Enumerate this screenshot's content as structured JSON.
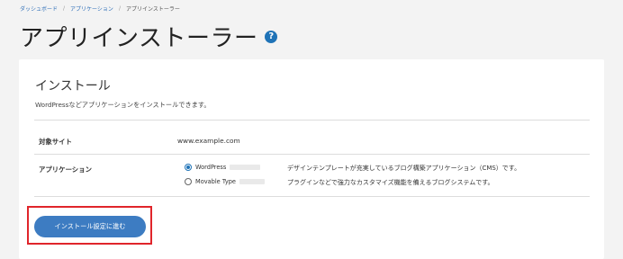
{
  "breadcrumb": {
    "items": [
      "ダッシュボード",
      "アプリケーション",
      "アプリインストーラー"
    ],
    "separator": "/"
  },
  "page": {
    "title": "アプリインストーラー",
    "help_icon": "question-circle-icon",
    "help_glyph": "?"
  },
  "section": {
    "title": "インストール",
    "description": "WordPressなどアプリケーションをインストールできます。"
  },
  "target_site": {
    "label": "対象サイト",
    "value": "www.example.com"
  },
  "application": {
    "label": "アプリケーション",
    "options": [
      {
        "name": "WordPress",
        "selected": true,
        "description": "デザインテンプレートが充実しているブログ構築アプリケーション（CMS）です。"
      },
      {
        "name": "Movable Type",
        "selected": false,
        "description": "プラグインなどで強力なカスタマイズ機能を備えるブログシステムです。"
      }
    ]
  },
  "actions": {
    "install_label": "インストール設定に進む"
  },
  "colors": {
    "accent": "#3d7cc2",
    "highlight": "#e0252b",
    "link": "#2f6fb8"
  }
}
